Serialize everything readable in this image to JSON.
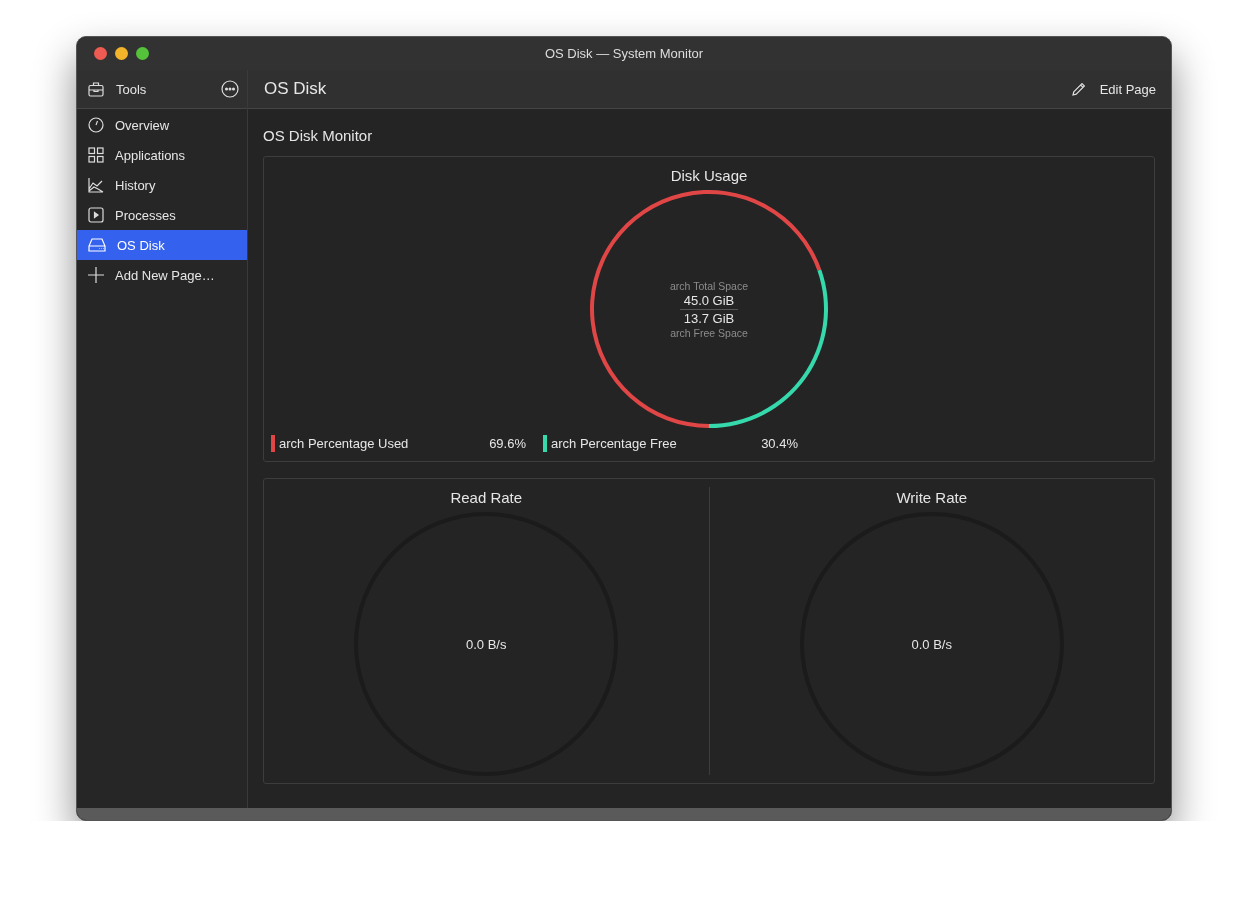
{
  "window": {
    "title": "OS Disk — System Monitor"
  },
  "sidebar": {
    "header": "Tools",
    "items": [
      {
        "label": "Overview",
        "selected": false
      },
      {
        "label": "Applications",
        "selected": false
      },
      {
        "label": "History",
        "selected": false
      },
      {
        "label": "Processes",
        "selected": false
      },
      {
        "label": "OS Disk",
        "selected": true
      },
      {
        "label": "Add New Page…",
        "selected": false
      }
    ]
  },
  "header": {
    "title": "OS Disk",
    "edit_button": "Edit Page"
  },
  "page_title": "OS Disk Monitor",
  "disk_usage": {
    "title": "Disk Usage",
    "total_label": "arch Total Space",
    "total_value": "45.0 GiB",
    "free_value": "13.7 GiB",
    "free_label": "arch Free Space",
    "chart_data": {
      "type": "donut",
      "categories": [
        "arch Percentage Used",
        "arch Percentage Free"
      ],
      "values": [
        69.6,
        30.4
      ]
    },
    "legend": [
      {
        "value": "69.6%",
        "color": "#e04646"
      },
      {
        "value": "30.4%",
        "color": "#35d9ac"
      }
    ]
  },
  "rates": [
    {
      "title": "Read Rate",
      "reading": "0.0 B/s"
    },
    {
      "title": "Write Rate",
      "reading": "0.0 B/s"
    }
  ]
}
